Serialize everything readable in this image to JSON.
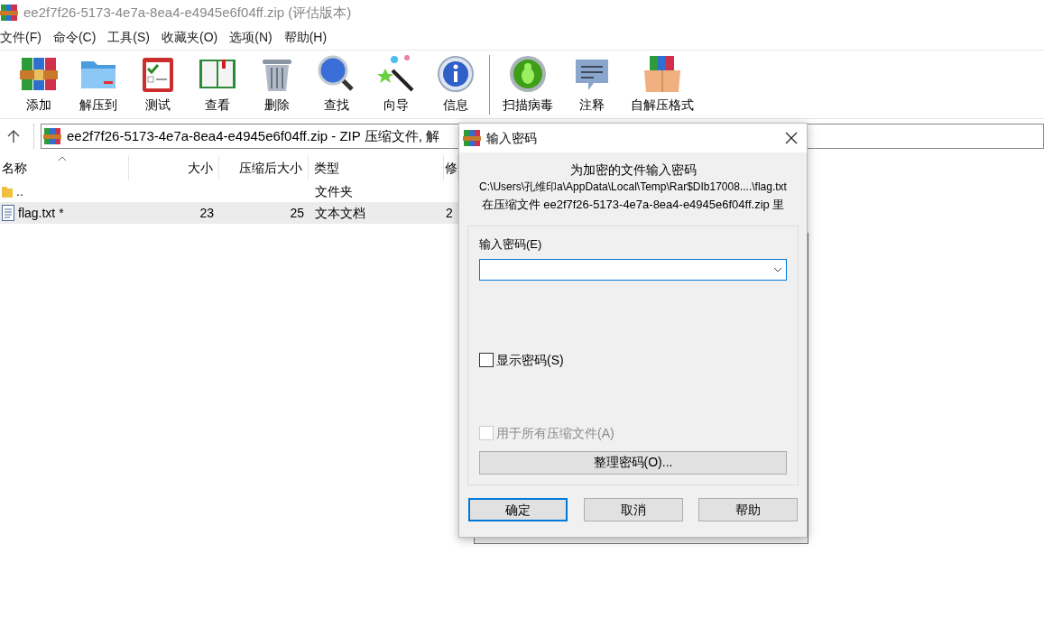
{
  "window": {
    "title": "ee2f7f26-5173-4e7a-8ea4-e4945e6f04ff.zip (评估版本)"
  },
  "menu": [
    "文件(F)",
    "命令(C)",
    "工具(S)",
    "收藏夹(O)",
    "选项(N)",
    "帮助(H)"
  ],
  "toolbar": [
    {
      "label": "添加"
    },
    {
      "label": "解压到"
    },
    {
      "label": "测试"
    },
    {
      "label": "查看"
    },
    {
      "label": "删除"
    },
    {
      "label": "查找"
    },
    {
      "label": "向导"
    },
    {
      "label": "信息"
    },
    {
      "label": "扫描病毒"
    },
    {
      "label": "注释"
    },
    {
      "label": "自解压格式"
    }
  ],
  "address": "ee2f7f26-5173-4e7a-8ea4-e4945e6f04ff.zip - ZIP 压缩文件, 解",
  "table": {
    "columns": [
      "名称",
      "大小",
      "压缩后大小",
      "类型",
      "修"
    ],
    "rows": [
      {
        "kind": "folder",
        "cells": [
          "..",
          "",
          "",
          "文件夹",
          ""
        ],
        "selected": false
      },
      {
        "kind": "file",
        "cells": [
          "flag.txt *",
          "23",
          "25",
          "文本文档",
          "2"
        ],
        "selected": true
      }
    ]
  },
  "dialog": {
    "title": "输入密码",
    "heading": "为加密的文件输入密码",
    "path": "C:\\Users\\孔维印a\\AppData\\Local\\Temp\\Rar$DIb17008....\\flag.txt",
    "archive_line": "在压缩文件 ee2f7f26-5173-4e7a-8ea4-e4945e6f04ff.zip 里",
    "password_label": "输入密码(E)",
    "checkboxes": [
      {
        "label": "显示密码(S)",
        "checked": false,
        "disabled": false
      },
      {
        "label": "用于所有压缩文件(A)",
        "checked": false,
        "disabled": true
      }
    ],
    "organize_button": "整理密码(O)...",
    "buttons": [
      {
        "label": "确定",
        "default": true
      },
      {
        "label": "取消",
        "default": false
      },
      {
        "label": "帮助",
        "default": false
      }
    ]
  }
}
